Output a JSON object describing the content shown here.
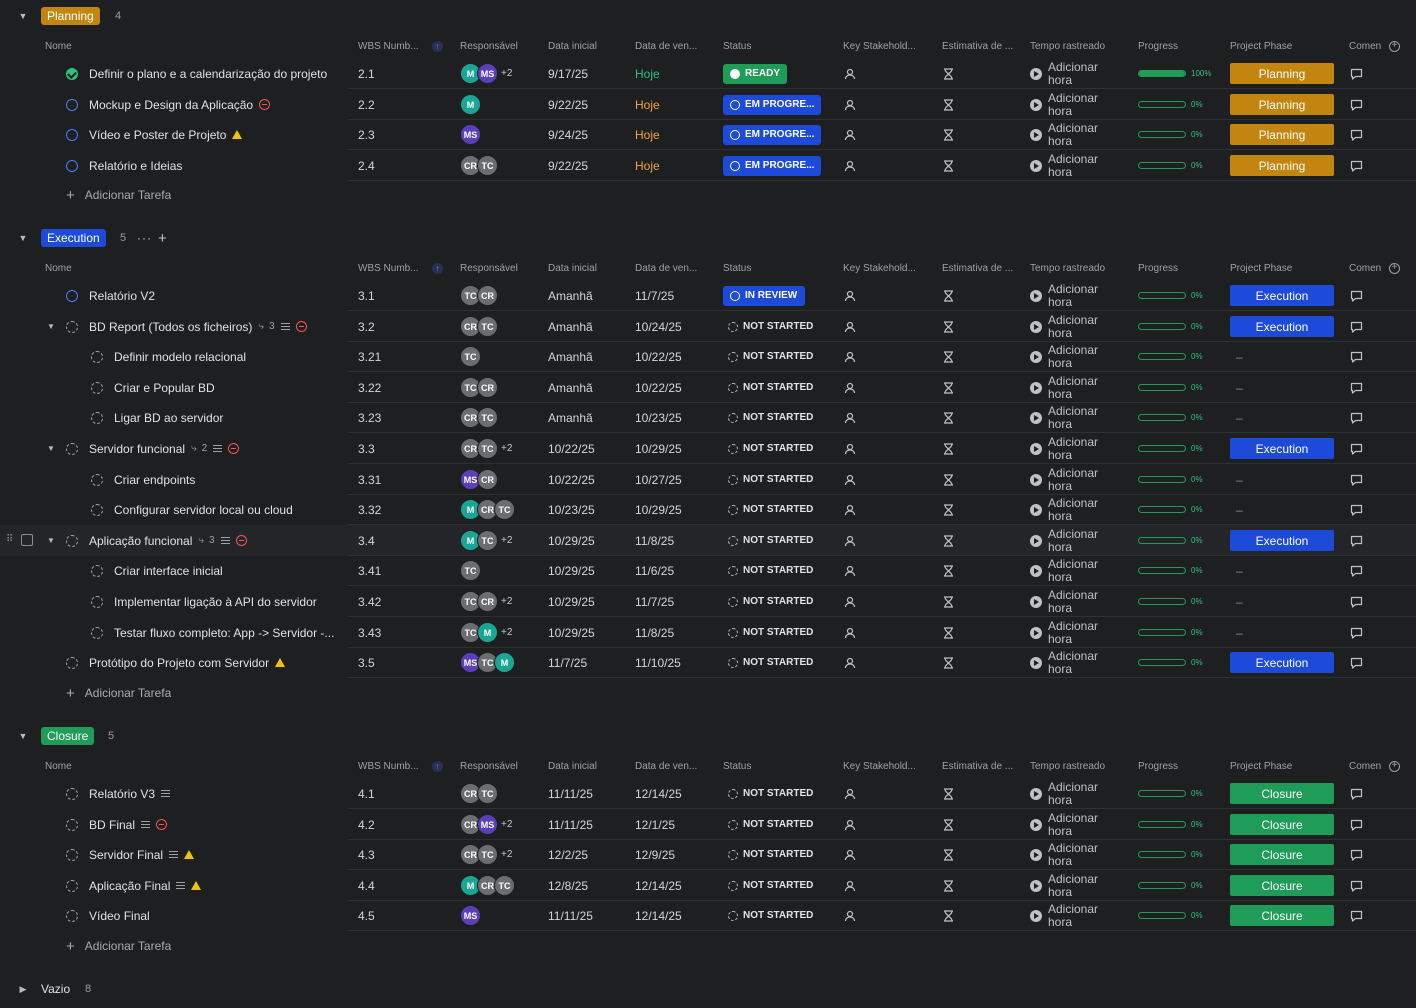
{
  "columns": {
    "name": "Nome",
    "wbs": "WBS Numb...",
    "resp": "Responsável",
    "start": "Data inicial",
    "due": "Data de ven...",
    "status": "Status",
    "key": "Key Stakehold...",
    "est": "Estimativa de ...",
    "track": "Tempo rastreado",
    "progress": "Progress",
    "phase": "Project Phase",
    "comments": "Comen"
  },
  "add_task": "Adicionar Tarefa",
  "track_label_1": "Adicionar",
  "track_label_2": "hora",
  "dash": "–",
  "colors": {
    "planning": "#c28510",
    "execution": "#1d4ad8",
    "closure": "#1f9c57"
  },
  "groups": [
    {
      "name": "Planning",
      "count": "4",
      "tasks": [
        {
          "name": "Definir o plano e a calendarização do projeto",
          "wbs": "2.1",
          "av": [
            "M",
            "MS"
          ],
          "more": "+2",
          "start": "9/17/25",
          "due": "Hoje",
          "dueColor": "#2ec27e",
          "status": "READY",
          "st": "ready",
          "progress": "100%",
          "frac": 1,
          "phase": "Planning",
          "icon": "done"
        },
        {
          "name": "Mockup e Design da Aplicação",
          "wbs": "2.2",
          "av": [
            "M"
          ],
          "start": "9/22/25",
          "due": "Hoje",
          "dueColor": "#f2a53a",
          "status": "EM PROGRE...",
          "st": "progress",
          "progress": "0%",
          "frac": 0,
          "phase": "Planning",
          "icon": "prog",
          "flags": [
            "block"
          ]
        },
        {
          "name": "Vídeo e Poster de Projeto",
          "wbs": "2.3",
          "av": [
            "MS"
          ],
          "start": "9/24/25",
          "due": "Hoje",
          "dueColor": "#f2a53a",
          "status": "EM PROGRE...",
          "st": "progress",
          "progress": "0%",
          "frac": 0,
          "phase": "Planning",
          "icon": "prog",
          "flags": [
            "warn"
          ]
        },
        {
          "name": "Relatório e Ideias",
          "wbs": "2.4",
          "av": [
            "CR",
            "TC"
          ],
          "start": "9/22/25",
          "due": "Hoje",
          "dueColor": "#f2a53a",
          "status": "EM PROGRE...",
          "st": "progress",
          "progress": "0%",
          "frac": 0,
          "phase": "Planning",
          "icon": "prog"
        }
      ]
    },
    {
      "name": "Execution",
      "count": "5",
      "tasks": [
        {
          "name": "Relatório V2",
          "wbs": "3.1",
          "av": [
            "TC",
            "CR"
          ],
          "start": "Amanhã",
          "due": "11/7/25",
          "status": "IN REVIEW",
          "st": "progress",
          "progress": "0%",
          "frac": 0,
          "phase": "Execution",
          "icon": "prog"
        },
        {
          "name": "BD Report (Todos os ficheiros)",
          "wbs": "3.2",
          "av": [
            "CR",
            "TC"
          ],
          "start": "Amanhã",
          "due": "10/24/25",
          "status": "NOT STARTED",
          "st": "ns",
          "progress": "0%",
          "frac": 0,
          "phase": "Execution",
          "icon": "ns",
          "parent": true,
          "sub": "3",
          "flags": [
            "lines",
            "block"
          ]
        },
        {
          "name": "Definir modelo relacional",
          "wbs": "3.21",
          "av": [
            "TC"
          ],
          "start": "Amanhã",
          "due": "10/22/25",
          "status": "NOT STARTED",
          "st": "ns",
          "progress": "0%",
          "frac": 0,
          "phase": "",
          "icon": "ns",
          "child": true
        },
        {
          "name": "Criar e Popular BD",
          "wbs": "3.22",
          "av": [
            "TC",
            "CR"
          ],
          "start": "Amanhã",
          "due": "10/22/25",
          "status": "NOT STARTED",
          "st": "ns",
          "progress": "0%",
          "frac": 0,
          "phase": "",
          "icon": "ns",
          "child": true
        },
        {
          "name": "Ligar BD ao servidor",
          "wbs": "3.23",
          "av": [
            "CR",
            "TC"
          ],
          "start": "Amanhã",
          "due": "10/23/25",
          "status": "NOT STARTED",
          "st": "ns",
          "progress": "0%",
          "frac": 0,
          "phase": "",
          "icon": "ns",
          "child": true
        },
        {
          "name": "Servidor funcional",
          "wbs": "3.3",
          "av": [
            "CR",
            "TC"
          ],
          "more": "+2",
          "start": "10/22/25",
          "due": "10/29/25",
          "status": "NOT STARTED",
          "st": "ns",
          "progress": "0%",
          "frac": 0,
          "phase": "Execution",
          "icon": "ns",
          "parent": true,
          "sub": "2",
          "flags": [
            "lines",
            "block"
          ]
        },
        {
          "name": "Criar endpoints",
          "wbs": "3.31",
          "av": [
            "MS",
            "CR"
          ],
          "start": "10/22/25",
          "due": "10/27/25",
          "status": "NOT STARTED",
          "st": "ns",
          "progress": "0%",
          "frac": 0,
          "phase": "",
          "icon": "ns",
          "child": true
        },
        {
          "name": "Configurar servidor local ou cloud",
          "wbs": "3.32",
          "av": [
            "M",
            "CR",
            "TC"
          ],
          "start": "10/23/25",
          "due": "10/29/25",
          "status": "NOT STARTED",
          "st": "ns",
          "progress": "0%",
          "frac": 0,
          "phase": "",
          "icon": "ns",
          "child": true
        },
        {
          "name": "Aplicação funcional",
          "wbs": "3.4",
          "av": [
            "M",
            "TC"
          ],
          "more": "+2",
          "start": "10/29/25",
          "due": "11/8/25",
          "status": "NOT STARTED",
          "st": "ns",
          "progress": "0%",
          "frac": 0,
          "phase": "Execution",
          "icon": "ns",
          "parent": true,
          "sub": "3",
          "flags": [
            "lines",
            "block"
          ],
          "hover": true
        },
        {
          "name": "Criar interface inicial",
          "wbs": "3.41",
          "av": [
            "TC"
          ],
          "start": "10/29/25",
          "due": "11/6/25",
          "status": "NOT STARTED",
          "st": "ns",
          "progress": "0%",
          "frac": 0,
          "phase": "",
          "icon": "ns",
          "child": true
        },
        {
          "name": "Implementar ligação à API do servidor",
          "wbs": "3.42",
          "av": [
            "TC",
            "CR"
          ],
          "more": "+2",
          "start": "10/29/25",
          "due": "11/7/25",
          "status": "NOT STARTED",
          "st": "ns",
          "progress": "0%",
          "frac": 0,
          "phase": "",
          "icon": "ns",
          "child": true
        },
        {
          "name": "Testar fluxo completo: App -> Servidor -...",
          "wbs": "3.43",
          "av": [
            "TC",
            "M"
          ],
          "more": "+2",
          "start": "10/29/25",
          "due": "11/8/25",
          "status": "NOT STARTED",
          "st": "ns",
          "progress": "0%",
          "frac": 0,
          "phase": "",
          "icon": "ns",
          "child": true
        },
        {
          "name": "Protótipo do Projeto com Servidor",
          "wbs": "3.5",
          "av": [
            "MS",
            "TC",
            "M"
          ],
          "start": "11/7/25",
          "due": "11/10/25",
          "status": "NOT STARTED",
          "st": "ns",
          "progress": "0%",
          "frac": 0,
          "phase": "Execution",
          "icon": "ns",
          "flags": [
            "warn"
          ]
        }
      ]
    },
    {
      "name": "Closure",
      "count": "5",
      "tasks": [
        {
          "name": "Relatório V3",
          "wbs": "4.1",
          "av": [
            "CR",
            "TC"
          ],
          "start": "11/11/25",
          "due": "12/14/25",
          "status": "NOT STARTED",
          "st": "ns",
          "progress": "0%",
          "frac": 0,
          "phase": "Closure",
          "icon": "ns",
          "flags": [
            "lines"
          ]
        },
        {
          "name": "BD Final",
          "wbs": "4.2",
          "av": [
            "CR",
            "MS"
          ],
          "more": "+2",
          "start": "11/11/25",
          "due": "12/1/25",
          "status": "NOT STARTED",
          "st": "ns",
          "progress": "0%",
          "frac": 0,
          "phase": "Closure",
          "icon": "ns",
          "flags": [
            "lines",
            "block"
          ]
        },
        {
          "name": "Servidor Final",
          "wbs": "4.3",
          "av": [
            "CR",
            "TC"
          ],
          "more": "+2",
          "start": "12/2/25",
          "due": "12/9/25",
          "status": "NOT STARTED",
          "st": "ns",
          "progress": "0%",
          "frac": 0,
          "phase": "Closure",
          "icon": "ns",
          "flags": [
            "lines",
            "warn"
          ]
        },
        {
          "name": "Aplicação Final",
          "wbs": "4.4",
          "av": [
            "M",
            "CR",
            "TC"
          ],
          "start": "12/8/25",
          "due": "12/14/25",
          "status": "NOT STARTED",
          "st": "ns",
          "progress": "0%",
          "frac": 0,
          "phase": "Closure",
          "icon": "ns",
          "flags": [
            "lines",
            "warn"
          ]
        },
        {
          "name": "Vídeo Final",
          "wbs": "4.5",
          "av": [
            "MS"
          ],
          "start": "11/11/25",
          "due": "12/14/25",
          "status": "NOT STARTED",
          "st": "ns",
          "progress": "0%",
          "frac": 0,
          "phase": "Closure",
          "icon": "ns"
        }
      ]
    }
  ],
  "empty_group": {
    "name": "Vazio",
    "count": "8"
  }
}
